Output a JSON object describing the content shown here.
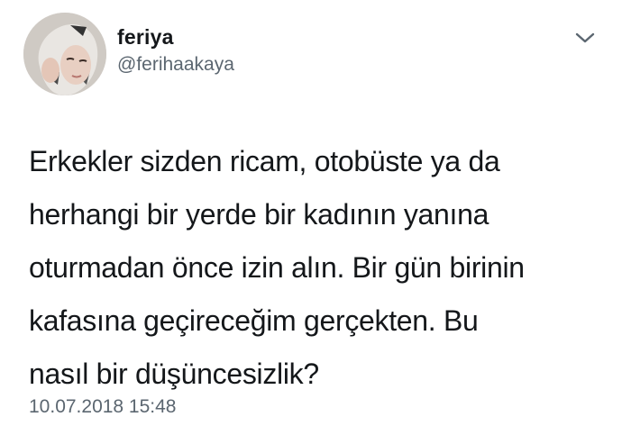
{
  "author": {
    "display_name": "feriya",
    "handle": "@ferihaakaya",
    "avatar_icon": "user-avatar-photo"
  },
  "menu": {
    "icon": "chevron-down-icon"
  },
  "tweet": {
    "text": "Erkekler sizden ricam, otobüste ya da\nherhangi bir yerde bir kadının yanına\noturmadan önce izin alın. Bir gün birinin\nkafasına geçireceğim gerçekten. Bu\nnasıl bir düşüncesizlik?",
    "timestamp": "10.07.2018 15:48"
  },
  "colors": {
    "text_primary": "#14171a",
    "text_secondary": "#5b6670",
    "background": "#ffffff"
  }
}
